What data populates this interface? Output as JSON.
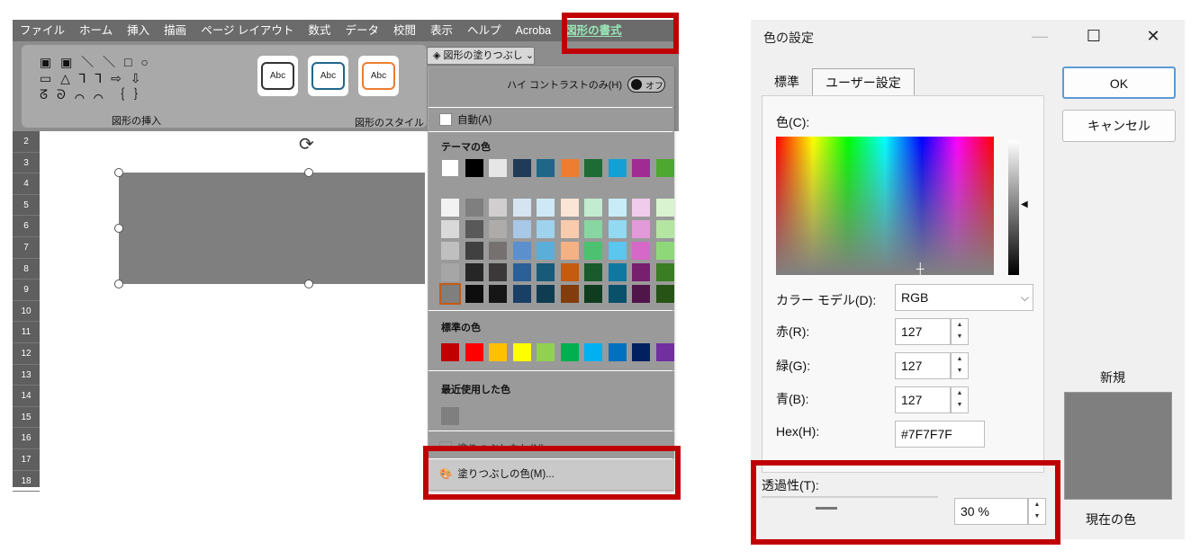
{
  "excel": {
    "tabs": [
      "ファイル",
      "ホーム",
      "挿入",
      "描画",
      "ページ レイアウト",
      "数式",
      "データ",
      "校閲",
      "表示",
      "ヘルプ",
      "Acroba",
      "図形の書式"
    ],
    "active_tab": "図形の書式",
    "shape_gallery_rows": [
      "▣ ▣ ＼ ＼ □ ○",
      "▭ △ ⅂ ⅂ ⇨ ⇩",
      "ᘔ ᘐ ⌒ ⌒ ｛ ｝"
    ],
    "group_insert_shapes": "図形の挿入",
    "group_shape_styles": "図形のスタイル",
    "style_samples": [
      "Abc",
      "Abc",
      "Abc"
    ],
    "fill_button": "図形の塗りつぶし",
    "row_numbers": [
      "2",
      "3",
      "4",
      "5",
      "6",
      "7",
      "8",
      "9",
      "10",
      "11",
      "12",
      "13",
      "14",
      "15",
      "16",
      "17",
      "18"
    ],
    "shape_color": "#7f7f7f",
    "dropdown": {
      "high_contrast": "ハイ コントラストのみ(H)",
      "toggle": "オフ",
      "auto": "自動(A)",
      "theme_colors_title": "テーマの色",
      "theme_top": [
        "#ffffff",
        "#000000",
        "#e7e6e6",
        "#1f3b57",
        "#1f6688",
        "#ed7d31",
        "#1e6b35",
        "#14a0d6",
        "#a02b93",
        "#4ea72e"
      ],
      "theme_shades": [
        [
          "#f2f2f2",
          "#7f7f7f",
          "#d0cece",
          "#d6e4f1",
          "#cfe8f5",
          "#fbe5d6",
          "#c2ebcf",
          "#c8ecf8",
          "#f1cbec",
          "#d9f2d0"
        ],
        [
          "#d9d9d9",
          "#595959",
          "#aeabab",
          "#a9c7e6",
          "#9fd2ec",
          "#f8cbad",
          "#88d6a2",
          "#92d9f2",
          "#e39ad9",
          "#b4e5a2"
        ],
        [
          "#bfbfbf",
          "#404040",
          "#757171",
          "#5b8fce",
          "#5aaed8",
          "#f4b183",
          "#4cc270",
          "#5bc6ee",
          "#d668c7",
          "#8fd87a"
        ],
        [
          "#a6a6a6",
          "#262626",
          "#3a3838",
          "#2a5f98",
          "#185a79",
          "#c55a11",
          "#1a5a2d",
          "#0e78a0",
          "#781f6e",
          "#3a7d22"
        ],
        [
          "#7f7f7f",
          "#0d0d0d",
          "#171616",
          "#1a3f66",
          "#0e3c51",
          "#833c0b",
          "#0f3c1e",
          "#09506b",
          "#501549",
          "#275317"
        ]
      ],
      "standard_title": "標準の色",
      "standard": [
        "#c00000",
        "#ff0000",
        "#ffc000",
        "#ffff00",
        "#92d050",
        "#00b050",
        "#00b0f0",
        "#0070c0",
        "#002060",
        "#7030a0"
      ],
      "recent_title": "最近使用した色",
      "recent": [
        "#7f7f7f"
      ],
      "no_fill": "塗りつぶしなし(N)",
      "more_colors": "塗りつぶしの色(M)..."
    }
  },
  "dialog": {
    "title": "色の設定",
    "minimize": "—",
    "maximize": "☐",
    "close": "✕",
    "tab_standard": "標準",
    "tab_custom": "ユーザー設定",
    "colors_label": "色(C):",
    "model_label": "カラー モデル(D):",
    "model_value": "RGB",
    "red_label": "赤(R):",
    "red_value": "127",
    "green_label": "緑(G):",
    "green_value": "127",
    "blue_label": "青(B):",
    "blue_value": "127",
    "hex_label": "Hex(H):",
    "hex_value": "#7F7F7F",
    "transparency_label": "透過性(T):",
    "transparency_value": "30 %",
    "ok": "OK",
    "cancel": "キャンセル",
    "new_label": "新規",
    "current_label": "現在の色",
    "preview_color": "#7f7f7f"
  }
}
